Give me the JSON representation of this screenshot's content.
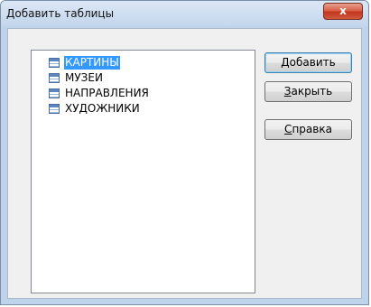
{
  "window": {
    "title": "Добавить таблицы",
    "close_symbol": "x"
  },
  "tables": [
    {
      "label": "КАРТИНЫ",
      "selected": true
    },
    {
      "label": "МУЗЕИ",
      "selected": false
    },
    {
      "label": "НАПРАВЛЕНИЯ",
      "selected": false
    },
    {
      "label": "ХУДОЖНИКИ",
      "selected": false
    }
  ],
  "buttons": {
    "add": {
      "hotkey": "Д",
      "rest": "обавить"
    },
    "close": {
      "hotkey": "З",
      "rest": "акрыть"
    },
    "help": {
      "hotkey": "С",
      "rest": "правка"
    }
  },
  "icons": {
    "table": "table-icon"
  },
  "colors": {
    "selection": "#3399ff",
    "close_button": "#c3351f",
    "title_bar": "#c4d6ec"
  }
}
